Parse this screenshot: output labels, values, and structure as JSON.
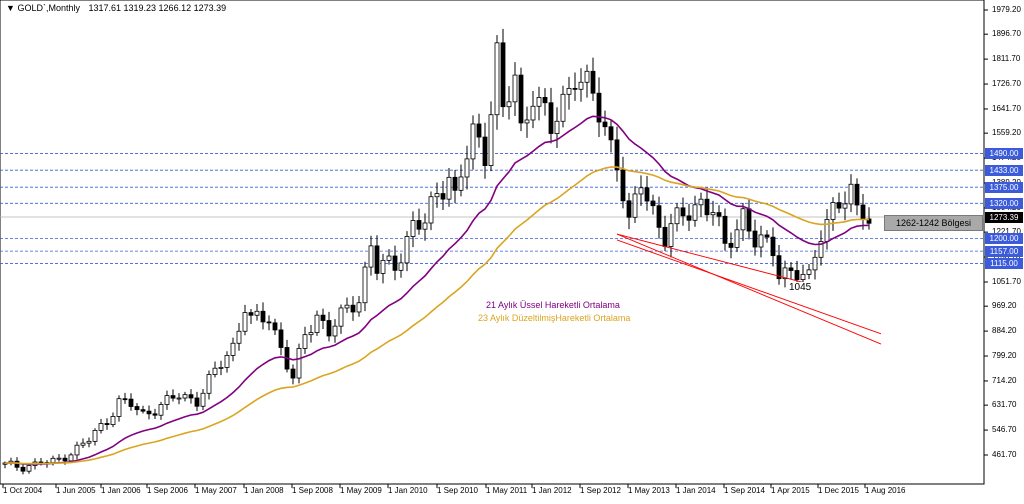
{
  "header": {
    "symbol": "GOLD`,Monthly",
    "ohlc": "1317.61 1319.23 1266.12 1273.39"
  },
  "chart_data": {
    "type": "candlestick",
    "symbol": "GOLD",
    "timeframe": "Monthly",
    "current_price": "1273.39",
    "y_ticks": [
      "1979.20",
      "1896.70",
      "1811.70",
      "1726.70",
      "1641.70",
      "1559.20",
      "1474.20",
      "1389.20",
      "1304.20",
      "1221.70",
      "1136.70",
      "1051.70",
      "969.20",
      "884.20",
      "799.20",
      "714.20",
      "631.70",
      "546.70",
      "461.70"
    ],
    "x_ticks": [
      "1 Oct 2004",
      "1 Jun 2005",
      "1 Jan 2006",
      "1 Sep 2006",
      "1 May 2007",
      "1 Jan 2008",
      "1 Sep 2008",
      "1 May 2009",
      "1 Jan 2010",
      "1 Sep 2010",
      "1 May 2011",
      "1 Jan 2012",
      "1 Sep 2012",
      "1 May 2013",
      "1 Jan 2014",
      "1 Sep 2014",
      "1 Apr 2015",
      "1 Dec 2015",
      "1 Aug 2016"
    ],
    "y_range": [
      420,
      2010
    ],
    "horizontal_levels": [
      {
        "value": 1490,
        "label": "1490.00"
      },
      {
        "value": 1433,
        "label": "1433.00"
      },
      {
        "value": 1375,
        "label": "1375.00"
      },
      {
        "value": 1320,
        "label": "1320.00"
      },
      {
        "value": 1200,
        "label": "1200.00"
      },
      {
        "value": 1157,
        "label": "1157.00"
      },
      {
        "value": 1115,
        "label": "1115.00"
      }
    ],
    "zone_label": "1262-1242 Bölgesi",
    "low_label": "1045",
    "indicators": [
      {
        "name": "21 Aylık Üssel Hareketli Ortalama",
        "color": "#800080"
      },
      {
        "name": "23 Aylık DüzeltilmişHareketli Ortalama",
        "color": "#DAA520"
      }
    ],
    "trend_lines": [
      {
        "x1": "2013-04",
        "y1": 1215,
        "x2": "2015-12",
        "y2": 1045,
        "color": "#FF0000"
      },
      {
        "x1": "2013-04",
        "y1": 1195,
        "x2": "2016-12",
        "y2": 875,
        "color": "#FF0000"
      },
      {
        "x1": "2013-04",
        "y1": 1215,
        "x2": "2016-12",
        "y2": 840,
        "color": "#FF0000"
      }
    ],
    "close_points": [
      [
        "2004-10",
        428
      ],
      [
        "2005-01",
        422
      ],
      [
        "2005-04",
        435
      ],
      [
        "2005-06",
        437
      ],
      [
        "2005-09",
        470
      ],
      [
        "2005-12",
        513
      ],
      [
        "2006-03",
        582
      ],
      [
        "2006-05",
        643
      ],
      [
        "2006-07",
        632
      ],
      [
        "2006-09",
        599
      ],
      [
        "2006-12",
        632
      ],
      [
        "2007-03",
        664
      ],
      [
        "2007-06",
        650
      ],
      [
        "2007-09",
        743
      ],
      [
        "2007-12",
        834
      ],
      [
        "2008-02",
        971
      ],
      [
        "2008-03",
        916
      ],
      [
        "2008-06",
        930
      ],
      [
        "2008-08",
        832
      ],
      [
        "2008-10",
        718
      ],
      [
        "2008-12",
        869
      ],
      [
        "2009-02",
        942
      ],
      [
        "2009-04",
        883
      ],
      [
        "2009-07",
        954
      ],
      [
        "2009-09",
        1001
      ],
      [
        "2009-11",
        1177
      ],
      [
        "2009-12",
        1096
      ],
      [
        "2010-03",
        1112
      ],
      [
        "2010-06",
        1244
      ],
      [
        "2010-08",
        1246
      ],
      [
        "2010-10",
        1357
      ],
      [
        "2010-12",
        1421
      ],
      [
        "2011-01",
        1333
      ],
      [
        "2011-04",
        1556
      ],
      [
        "2011-06",
        1500
      ],
      [
        "2011-08",
        1826
      ],
      [
        "2011-09",
        1620
      ],
      [
        "2011-11",
        1746
      ],
      [
        "2011-12",
        1565
      ],
      [
        "2012-02",
        1711
      ],
      [
        "2012-05",
        1562
      ],
      [
        "2012-09",
        1772
      ],
      [
        "2012-12",
        1675
      ],
      [
        "2013-02",
        1578
      ],
      [
        "2013-04",
        1472
      ],
      [
        "2013-06",
        1234
      ],
      [
        "2013-08",
        1396
      ],
      [
        "2013-12",
        1202
      ],
      [
        "2014-03",
        1284
      ],
      [
        "2014-06",
        1327
      ],
      [
        "2014-08",
        1287
      ],
      [
        "2014-10",
        1171
      ],
      [
        "2015-01",
        1284
      ],
      [
        "2015-03",
        1183
      ],
      [
        "2015-06",
        1172
      ],
      [
        "2015-07",
        1095
      ],
      [
        "2015-11",
        1065
      ],
      [
        "2015-12",
        1061
      ],
      [
        "2016-02",
        1238
      ],
      [
        "2016-04",
        1293
      ],
      [
        "2016-06",
        1322
      ],
      [
        "2016-07",
        1351
      ],
      [
        "2016-08",
        1309
      ],
      [
        "2016-09",
        1317
      ],
      [
        "2016-10",
        1273
      ]
    ]
  }
}
